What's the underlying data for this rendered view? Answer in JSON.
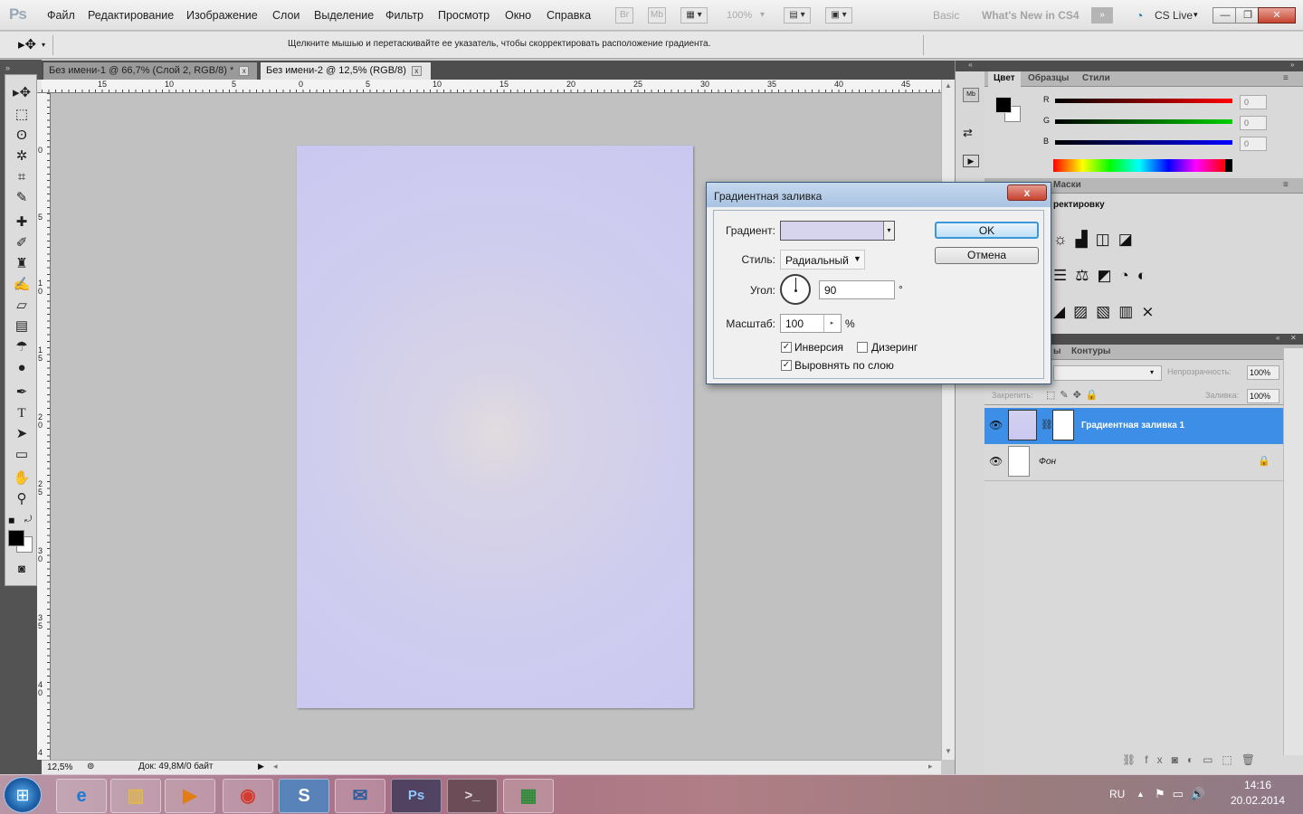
{
  "app": {
    "logo": "Ps"
  },
  "menu": [
    "Файл",
    "Редактирование",
    "Изображение",
    "Слои",
    "Выделение",
    "Фильтр",
    "Просмотр",
    "Окно",
    "Справка"
  ],
  "menubar_tools": {
    "bridge": "Br",
    "minibridge": "Mb",
    "zoom": "100%"
  },
  "workspace": {
    "basic": "Basic",
    "whats_new": "What's New in CS4",
    "cslive": "CS Live"
  },
  "window_controls": {
    "minimize": "—",
    "restore": "❐",
    "close": "✕"
  },
  "options_bar": {
    "hint": "Щелкните мышью и перетаскивайте ее указатель, чтобы скорректировать расположение градиента."
  },
  "doc_tabs": [
    {
      "label": "Без имени-1 @ 66,7% (Слой 2, RGB/8) *",
      "active": false
    },
    {
      "label": "Без имени-2 @ 12,5% (RGB/8)",
      "active": true
    }
  ],
  "ruler_h": [
    "15",
    "10",
    "5",
    "0",
    "5",
    "10",
    "15",
    "20",
    "25",
    "30",
    "35",
    "40",
    "45"
  ],
  "ruler_v": [
    "0",
    "5",
    "1 0",
    "1 5",
    "2 0",
    "2 5",
    "3 0",
    "3 5",
    "4 0",
    "4"
  ],
  "status": {
    "zoom": "12,5%",
    "doc": "Док: 49,8M/0 байт"
  },
  "color_panel": {
    "tabs": [
      "Цвет",
      "Образцы",
      "Стили"
    ],
    "channels": [
      {
        "label": "R",
        "value": "0",
        "color": "#ff0000"
      },
      {
        "label": "G",
        "value": "0",
        "color": "#00c800"
      },
      {
        "label": "B",
        "value": "0",
        "color": "#0000ff"
      }
    ],
    "fg": "#000000",
    "bg": "#ffffff"
  },
  "adjust_panel": {
    "tab": "Маски",
    "title": "ректировку"
  },
  "layers_panel": {
    "tabs": [
      "ы",
      "Контуры"
    ],
    "opacity_label": "Непрозрачность:",
    "opacity": "100%",
    "lock_label": "Закрепить:",
    "fill_label": "Заливка:",
    "fill": "100%",
    "layers": [
      {
        "name": "Градиентная заливка 1",
        "selected": true
      },
      {
        "name": "Фон",
        "selected": false
      }
    ],
    "footer_fx": "fx"
  },
  "dialog": {
    "title": "Градиентная заливка",
    "close": "x",
    "gradient_label": "Градиент:",
    "style_label": "Стиль:",
    "style_value": "Радиальный",
    "angle_label": "Угол:",
    "angle_value": "90",
    "angle_unit": "°",
    "scale_label": "Масштаб:",
    "scale_value": "100",
    "scale_unit": "%",
    "invert_label": "Инверсия",
    "invert_checked": true,
    "dither_label": "Дизеринг",
    "dither_checked": false,
    "align_label": "Выровнять по слою",
    "align_checked": true,
    "ok": "OK",
    "cancel": "Отмена"
  },
  "taskbar": {
    "apps": [
      "Internet Explorer",
      "Проводник",
      "Media Player",
      "Chrome",
      "Skype",
      "Thunderbird",
      "Photoshop",
      "Консоль",
      "Калькулятор"
    ],
    "lang": "RU",
    "time": "14:16",
    "date": "20.02.2014"
  }
}
